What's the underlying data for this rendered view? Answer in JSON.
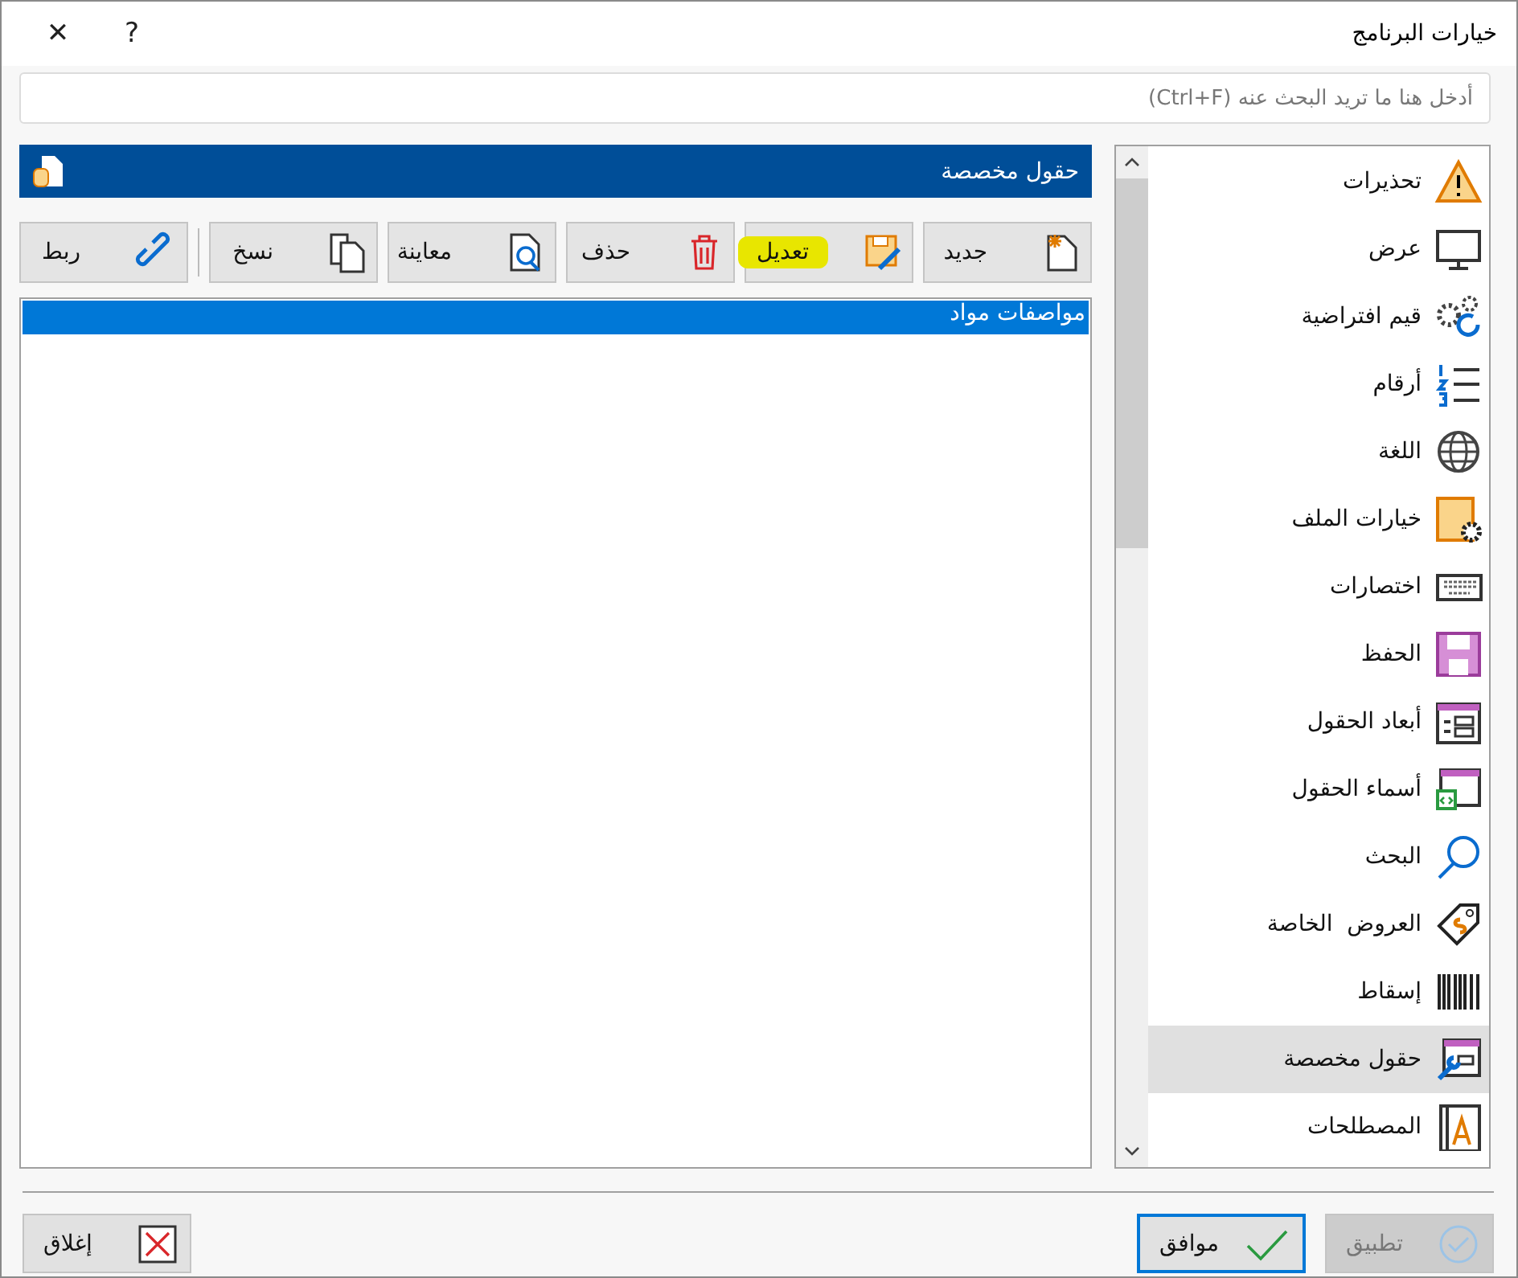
{
  "window": {
    "title": "خيارات البرنامج",
    "help": "?",
    "close": "✕"
  },
  "search": {
    "placeholder": "أدخل هنا ما تريد البحث عنه (Ctrl+F)"
  },
  "panel": {
    "title": "حقول مخصصة"
  },
  "toolbar": [
    {
      "label": "جديد",
      "highlighted": false
    },
    {
      "label": "تعديل",
      "highlighted": true
    },
    {
      "label": "حذف",
      "highlighted": false
    },
    {
      "label": "معاينة",
      "highlighted": false
    },
    {
      "label": "نسخ",
      "highlighted": false
    },
    {
      "label": "ربط",
      "highlighted": false
    }
  ],
  "list": [
    {
      "label": "مواصفات مواد",
      "selected": true
    }
  ],
  "sidebar": {
    "items": [
      {
        "label": "تحذيرات",
        "selected": false
      },
      {
        "label": "عرض",
        "selected": false
      },
      {
        "label": "قيم افتراضية",
        "selected": false
      },
      {
        "label": "أرقام",
        "selected": false
      },
      {
        "label": "اللغة",
        "selected": false
      },
      {
        "label": "خيارات الملف",
        "selected": false
      },
      {
        "label": "اختصارات",
        "selected": false
      },
      {
        "label": "الحفظ",
        "selected": false
      },
      {
        "label": "أبعاد الحقول",
        "selected": false
      },
      {
        "label": "أسماء الحقول",
        "selected": false
      },
      {
        "label": "البحث",
        "selected": false
      },
      {
        "label": "العروض  الخاصة",
        "selected": false
      },
      {
        "label": "إسقاط",
        "selected": false
      },
      {
        "label": "حقول مخصصة",
        "selected": true
      },
      {
        "label": "المصطلحات",
        "selected": false
      }
    ]
  },
  "buttons": [
    {
      "label": "تطبيق",
      "disabled": true
    },
    {
      "label": "موافق",
      "disabled": false,
      "default": true
    },
    {
      "label": "إغلاق",
      "disabled": false
    }
  ]
}
